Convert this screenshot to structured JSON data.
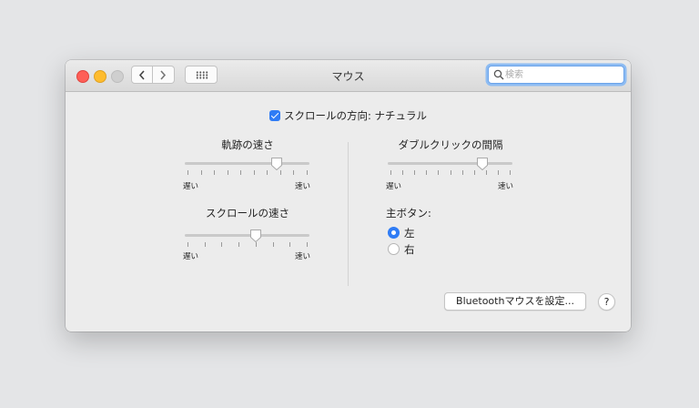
{
  "window": {
    "title": "マウス",
    "search": {
      "placeholder": "検索",
      "value": ""
    }
  },
  "scroll_direction": {
    "label": "スクロールの方向: ナチュラル",
    "checked": true
  },
  "tracking_speed": {
    "title": "軌跡の速さ",
    "min_label": "遅い",
    "max_label": "速い",
    "value": 0.75,
    "ticks": 10
  },
  "scroll_speed": {
    "title": "スクロールの速さ",
    "min_label": "遅い",
    "max_label": "速い",
    "value": 0.57,
    "ticks": 8
  },
  "double_click": {
    "title": "ダブルクリックの間隔",
    "min_label": "遅い",
    "max_label": "速い",
    "value": 0.77,
    "ticks": 11
  },
  "primary_button": {
    "label": "主ボタン:",
    "options": [
      {
        "label": "左",
        "selected": true
      },
      {
        "label": "右",
        "selected": false
      }
    ]
  },
  "bluetooth_button": {
    "label": "Bluetoothマウスを設定..."
  },
  "help_button": {
    "label": "?"
  },
  "colors": {
    "accent": "#2f7cf5",
    "close": "#fe5f57",
    "minimize": "#febc2e"
  }
}
